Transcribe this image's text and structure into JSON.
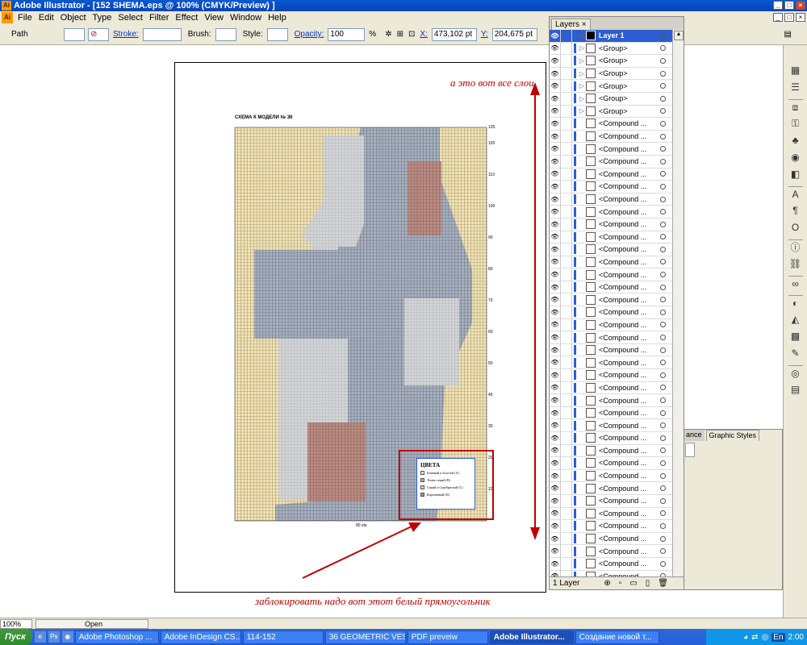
{
  "window": {
    "title": "Adobe Illustrator - [152 SHEMA.eps @ 100% (CMYK/Preview) ]",
    "app_icon": "Ai"
  },
  "menu": [
    "File",
    "Edit",
    "Object",
    "Type",
    "Select",
    "Filter",
    "Effect",
    "View",
    "Window",
    "Help"
  ],
  "control_bar": {
    "object_type": "Path",
    "stroke_label": "Stroke:",
    "brush_label": "Brush:",
    "style_label": "Style:",
    "opacity_label": "Opacity:",
    "opacity_value": "100",
    "opacity_unit": "%",
    "x_label": "X:",
    "x_value": "473,102 pt",
    "y_label": "Y:",
    "y_value": "204,675 pt"
  },
  "document": {
    "scheme_title": "СХЕМА К МОДЕЛИ № 36",
    "y_ticks": [
      "125",
      "120",
      "110",
      "100",
      "90",
      "80",
      "70",
      "60",
      "50",
      "40",
      "30",
      "20",
      "10"
    ],
    "x_label": "80 sts",
    "colors_legend": {
      "title": "ЦВЕТА",
      "items": [
        {
          "label": "Бежевый и Золотой (A)",
          "color": "#f3e3b4"
        },
        {
          "label": "Темно-серый (B)",
          "color": "#a6afbd"
        },
        {
          "label": "Серый и Серебристый (C)",
          "color": "#d3d4d6"
        },
        {
          "label": "Коричневый (D)",
          "color": "#b98b82"
        }
      ]
    }
  },
  "annotations": {
    "top": "а это вот все слои",
    "bottom": "заблокировать надо вот этот белый прямоугольник"
  },
  "layers_panel": {
    "tab": "Layers",
    "layer_name": "Layer 1",
    "groups": [
      "<Group>",
      "<Group>",
      "<Group>",
      "<Group>",
      "<Group>",
      "<Group>"
    ],
    "compound_label": "<Compound ...",
    "compound_count": 37,
    "footer": "1 Layer"
  },
  "graphic_styles_panel": {
    "tabs": [
      "ance",
      "Graphic Styles"
    ]
  },
  "status_bar": {
    "zoom": "100%",
    "status": "Open"
  },
  "taskbar": {
    "start": "Пуск",
    "items": [
      {
        "label": "Adobe Photoshop ...",
        "active": false
      },
      {
        "label": "Adobe InDesign CS...",
        "active": false
      },
      {
        "label": "114-152",
        "active": false
      },
      {
        "label": "36 GEOMETRIC VEST",
        "active": false
      },
      {
        "label": "PDF preveiw",
        "active": false
      },
      {
        "label": "Adobe Illustrator...",
        "active": true
      },
      {
        "label": "Создание новой т...",
        "active": false
      }
    ],
    "lang": "En",
    "clock": "2:00"
  }
}
